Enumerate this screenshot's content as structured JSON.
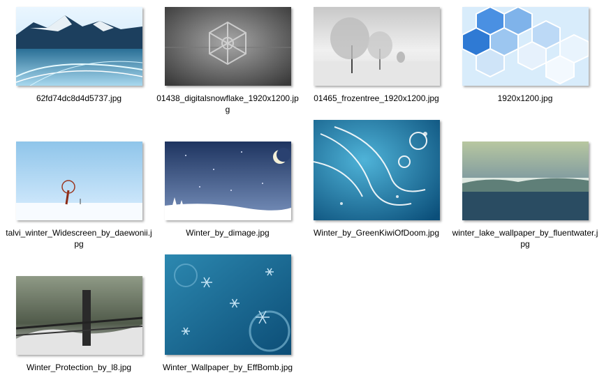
{
  "files": [
    {
      "name": "62fd74dc8d4d5737.jpg",
      "thumb_icon": "mountain-lake-thumbnail"
    },
    {
      "name": "01438_digitalsnowflake_1920x1200.jpg",
      "thumb_icon": "digital-snowflake-thumbnail"
    },
    {
      "name": "01465_frozentree_1920x1200.jpg",
      "thumb_icon": "frozen-tree-thumbnail"
    },
    {
      "name": "1920x1200.jpg",
      "thumb_icon": "blue-hexagons-thumbnail"
    },
    {
      "name": "talvi_winter_Widescreen_by_daewonii.jpg",
      "thumb_icon": "lone-tree-snowfield-thumbnail"
    },
    {
      "name": "Winter_by_dimage.jpg",
      "thumb_icon": "night-moon-thumbnail"
    },
    {
      "name": "Winter_by_GreenKiwiOfDoom.jpg",
      "thumb_icon": "blue-swirls-thumbnail"
    },
    {
      "name": "winter_lake_wallpaper_by_fluentwater.jpg",
      "thumb_icon": "winter-lake-thumbnail"
    },
    {
      "name": "Winter_Protection_by_l8.jpg",
      "thumb_icon": "snowy-fence-thumbnail"
    },
    {
      "name": "Winter_Wallpaper_by_EffBomb.jpg",
      "thumb_icon": "snowflakes-pattern-thumbnail"
    }
  ]
}
